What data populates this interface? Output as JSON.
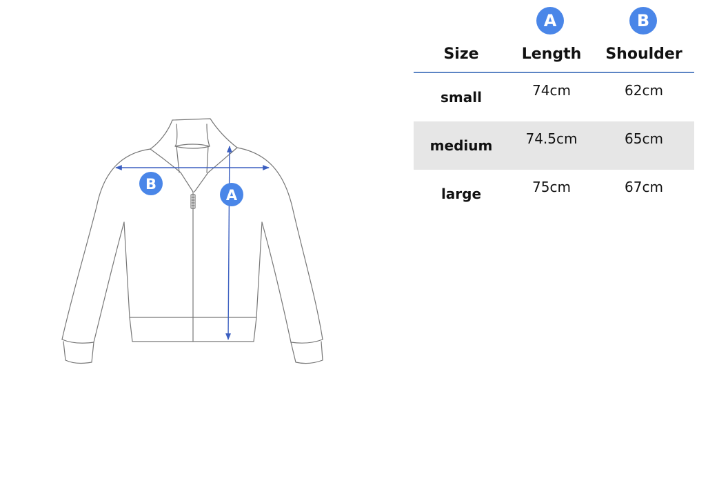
{
  "markers": {
    "length": "A",
    "shoulder": "B"
  },
  "table": {
    "headers": {
      "size": "Size",
      "length": "Length",
      "shoulder": "Shoulder"
    },
    "rows": [
      {
        "size": "small",
        "length": "74cm",
        "shoulder": "62cm"
      },
      {
        "size": "medium",
        "length": "74.5cm",
        "shoulder": "65cm"
      },
      {
        "size": "large",
        "length": "75cm",
        "shoulder": "67cm"
      }
    ]
  },
  "colors": {
    "accent": "#4a86e8",
    "measure_line": "#3b5fc0",
    "outline": "#777777",
    "row_shade": "#e6e6e6",
    "rule": "#5b84c4"
  },
  "icons": {
    "illustration": "jacket-outline-icon"
  }
}
